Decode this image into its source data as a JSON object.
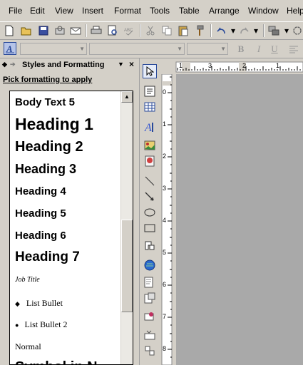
{
  "menu": [
    "File",
    "Edit",
    "View",
    "Insert",
    "Format",
    "Tools",
    "Table",
    "Arrange",
    "Window",
    "Help"
  ],
  "panel": {
    "title": "Styles and Formatting",
    "pick_label": "Pick formatting to apply",
    "styles": [
      "Body Text 5",
      "Heading 1",
      "Heading 2",
      "Heading 3",
      "Heading 4",
      "Heading 5",
      "Heading 6",
      "Heading 7",
      "Job Title",
      "List Bullet",
      "List Bullet 2",
      "Normal",
      "Symbol in N"
    ]
  },
  "format_toolbar": {
    "bold": "B",
    "italic": "I",
    "underline": "U"
  },
  "ruler": {
    "top_numbers": [
      "1",
      "3",
      "2",
      "1"
    ],
    "left_numbers": [
      "0",
      "1",
      "2",
      "3",
      "4",
      "5",
      "6",
      "7",
      "8"
    ]
  },
  "colors": {
    "chrome": "#d4d0c8",
    "canvas": "#a9a9a9"
  }
}
